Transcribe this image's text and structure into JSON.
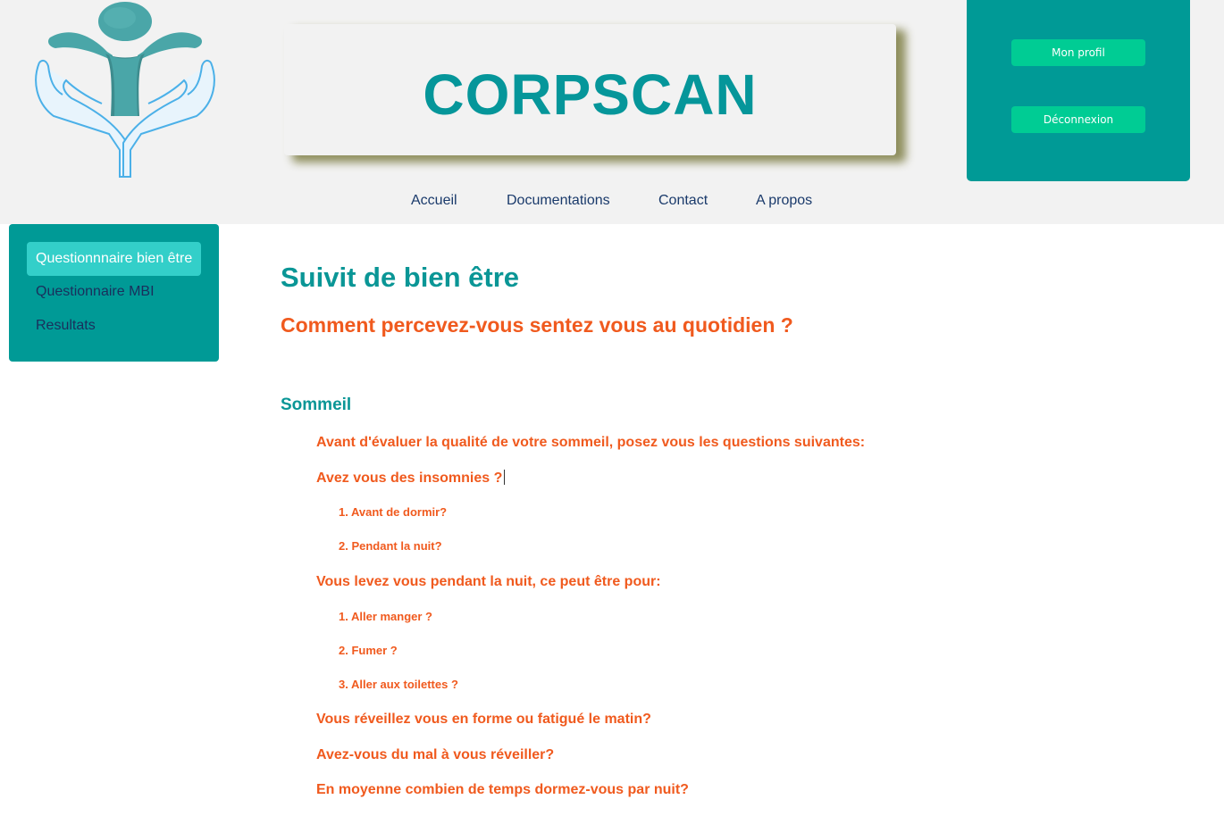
{
  "header": {
    "site_title": "CORPSCAN",
    "profile_label": "Mon profil",
    "logout_label": "Déconnexion"
  },
  "nav": {
    "items": [
      {
        "label": "Accueil"
      },
      {
        "label": "Documentations"
      },
      {
        "label": "Contact"
      },
      {
        "label": "A propos"
      }
    ]
  },
  "sidebar": {
    "items": [
      {
        "label": "Questionnnaire bien être",
        "active": true
      },
      {
        "label": "Questionnaire MBI",
        "active": false
      },
      {
        "label": "Resultats",
        "active": false
      }
    ]
  },
  "main": {
    "page_title": "Suivit de bien être",
    "subtitle": "Comment percevez-vous sentez vous au quotidien ?",
    "section_title": "Sommeil",
    "intro": "Avant d'évaluer la qualité de votre sommeil, posez vous les questions suivantes:",
    "q_insomnia": "Avez vous des insomnies ?",
    "insomnia_options": [
      "1. Avant de dormir?",
      "2. Pendant la nuit?"
    ],
    "q_night": "Vous levez vous pendant la nuit, ce peut être pour:",
    "night_options": [
      "1. Aller manger ?",
      "2. Fumer ?",
      "3. Aller aux toilettes ?"
    ],
    "q_wakeup": "Vous réveillez vous en forme ou fatigué le matin?",
    "q_hard_wake": "Avez-vous du mal à vous réveiller?",
    "q_hours": "En moyenne combien de temps dormez-vous par nuit?"
  },
  "colors": {
    "teal": "#009a96",
    "title_teal": "#05969a",
    "orange": "#f05a1e",
    "button_green": "#00cc94",
    "active_item": "#33cfc9",
    "header_bg": "#f2f2f2"
  },
  "icons": {
    "logo": "person-in-hands-logo"
  }
}
